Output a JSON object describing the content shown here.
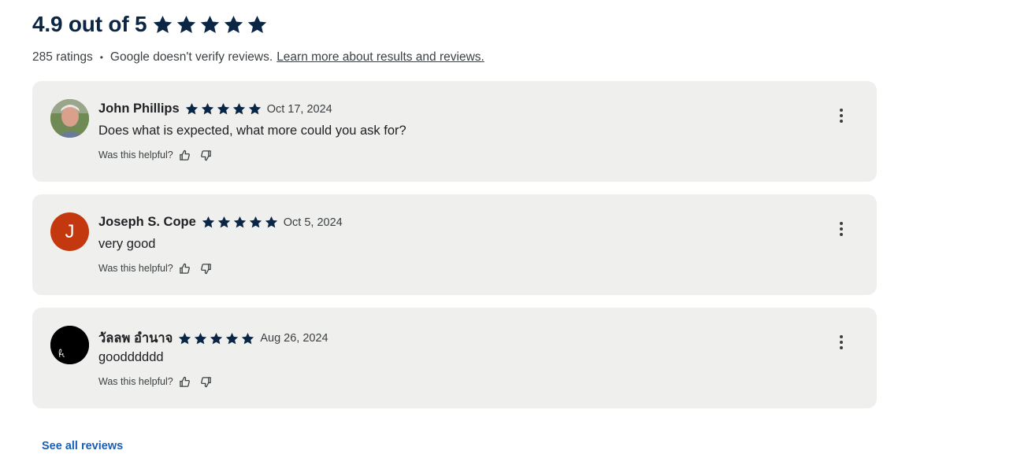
{
  "summary": {
    "score_text": "4.9 out of 5",
    "rating": 4.9,
    "ratings_count": "285 ratings",
    "separator": "•",
    "disclaimer": "Google doesn't verify reviews.",
    "learn_more_link": "Learn more about results and reviews."
  },
  "reviews": [
    {
      "name": "John Phillips",
      "stars": 5,
      "date": "Oct 17, 2024",
      "text": "Does what is expected, what more could you ask for?",
      "helpful_prompt": "Was this helpful?",
      "avatar_type": "photo",
      "avatar_letter": ""
    },
    {
      "name": "Joseph S. Cope",
      "stars": 5,
      "date": "Oct 5, 2024",
      "text": "very good",
      "helpful_prompt": "Was this helpful?",
      "avatar_type": "letter",
      "avatar_letter": "J"
    },
    {
      "name": "วัลลพ อำนาจ",
      "stars": 5,
      "date": "Aug 26, 2024",
      "text": "goodddddd",
      "helpful_prompt": "Was this helpful?",
      "avatar_type": "signature",
      "avatar_letter": ""
    }
  ],
  "footer": {
    "see_all_link": "See all reviews"
  },
  "icons": {
    "star": "star-icon",
    "thumb_up": "thumbs-up-icon",
    "thumb_down": "thumbs-down-icon",
    "more": "more-vert-icon"
  },
  "colors": {
    "star": "#0b2545",
    "card_bg": "#eff0ee",
    "link": "#1a5fb4",
    "avatar_letter_bg": "#c4380f"
  }
}
